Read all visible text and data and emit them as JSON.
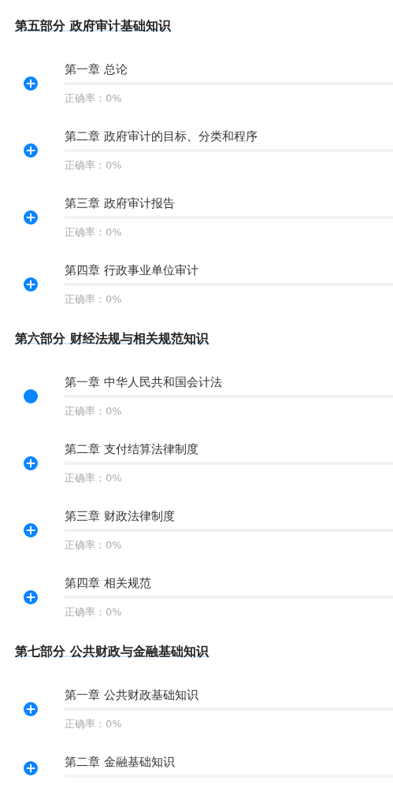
{
  "sections": [
    {
      "title": "第五部分 政府审计基础知识",
      "chapters": [
        {
          "kind": "plus",
          "title": "第一章 总论",
          "level": 0,
          "accuracy": "正确率：0%"
        },
        {
          "kind": "plus",
          "title": "第二章 政府审计的目标、分类和程序",
          "level": 0,
          "accuracy": "正确率：0%"
        },
        {
          "kind": "plus",
          "title": "第三章 政府审计报告",
          "level": 0,
          "accuracy": "正确率：0%"
        },
        {
          "kind": "plus",
          "title": "第四章 行政事业单位审计",
          "level": 0,
          "accuracy": "正确率：0%"
        }
      ]
    },
    {
      "title": "第六部分 财经法规与相关规范知识",
      "chapters": [
        {
          "kind": "dot",
          "title": "第一章 中华人民共和国会计法",
          "level": 0,
          "accuracy": "正确率：0%"
        },
        {
          "kind": "plus",
          "title": "第二章 支付结算法律制度",
          "level": 0,
          "accuracy": "正确率：0%"
        },
        {
          "kind": "plus",
          "title": "第三章 财政法律制度",
          "level": 0,
          "accuracy": "正确率：0%"
        },
        {
          "kind": "plus",
          "title": "第四章 相关规范",
          "level": 0,
          "accuracy": "正确率：0%"
        }
      ]
    },
    {
      "title": "第七部分 公共财政与金融基础知识",
      "chapters": [
        {
          "kind": "plus",
          "title": "第一章 公共财政基础知识",
          "level": 0,
          "accuracy": "正确率：0%"
        },
        {
          "kind": "plus",
          "title": "第二章 金融基础知识",
          "level": 0
        }
      ]
    }
  ]
}
